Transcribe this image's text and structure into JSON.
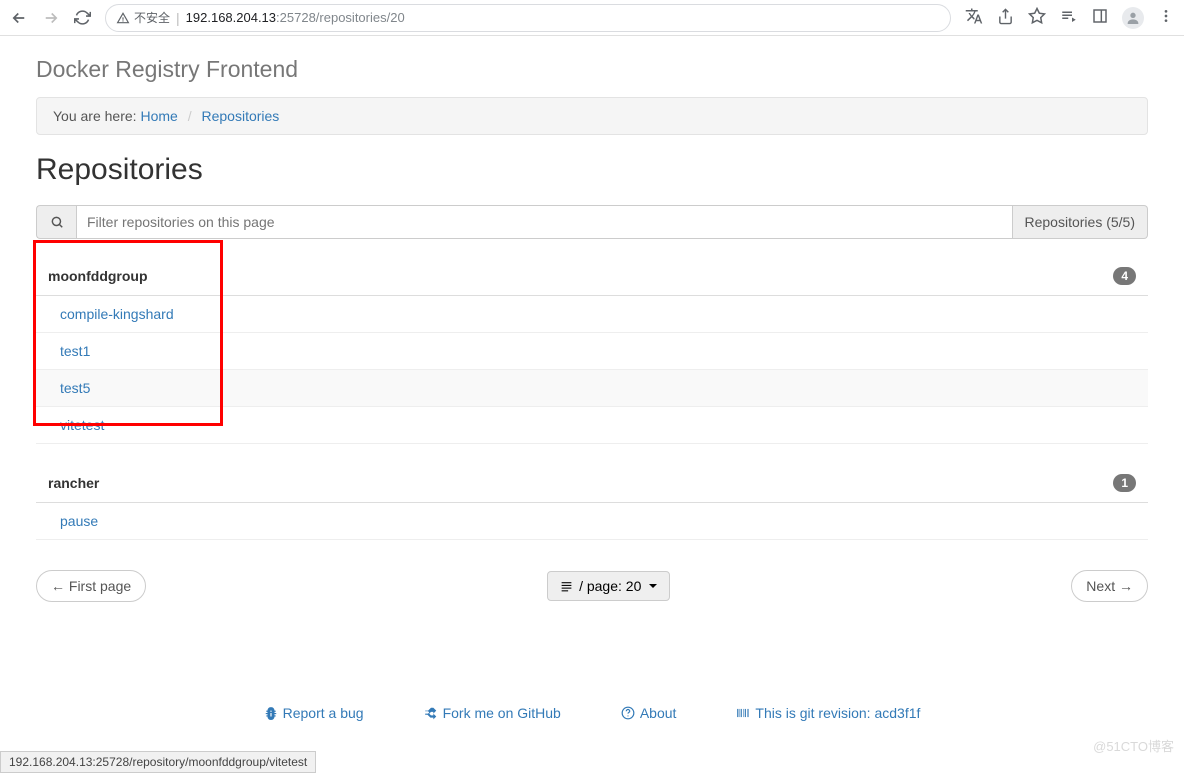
{
  "browser": {
    "insecure_label": "不安全",
    "url_host": "192.168.204.13",
    "url_port": ":25728",
    "url_path": "/repositories/20"
  },
  "app_title": "Docker Registry Frontend",
  "breadcrumb": {
    "prefix": "You are here:",
    "home": "Home",
    "repositories": "Repositories"
  },
  "heading": "Repositories",
  "search": {
    "placeholder": "Filter repositories on this page",
    "count_label": "Repositories (5/5)"
  },
  "groups": [
    {
      "name": "moonfddgroup",
      "count": "4",
      "items": [
        "compile-kingshard",
        "test1",
        "test5",
        "vitetest"
      ]
    },
    {
      "name": "rancher",
      "count": "1",
      "items": [
        "pause"
      ]
    }
  ],
  "pager": {
    "first": "← First page",
    "per_page": "/ page: 20",
    "next": "Next →"
  },
  "footer": {
    "report": "Report a bug",
    "fork": "Fork me on GitHub",
    "about": "About",
    "revision": "This is git revision: acd3f1f"
  },
  "status_bar": "192.168.204.13:25728/repository/moonfddgroup/vitetest",
  "watermark": "@51CTO博客"
}
